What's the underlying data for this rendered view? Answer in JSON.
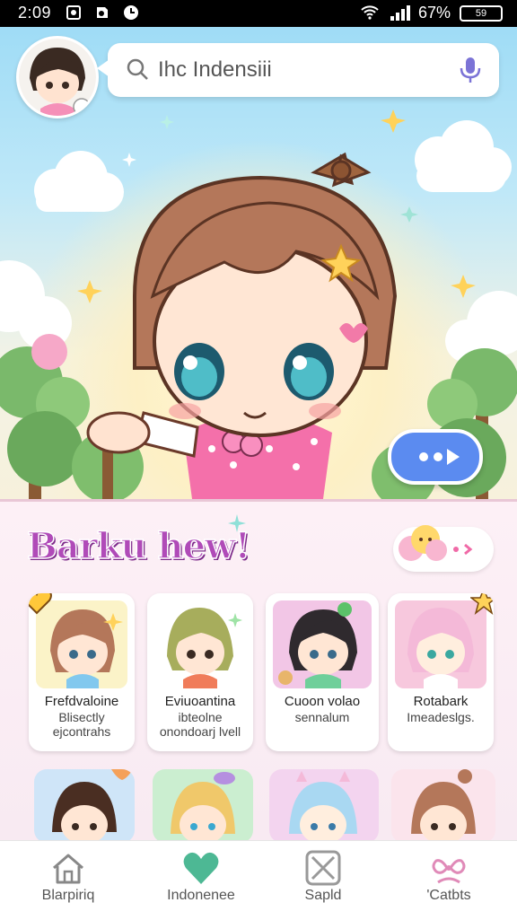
{
  "status_bar": {
    "time": "2:09",
    "battery_percent": "67%",
    "battery_label": "59"
  },
  "search": {
    "placeholder_text": "Ihc Indensiii"
  },
  "section": {
    "title": "Barku hew!"
  },
  "cards": [
    {
      "line1": "Frefdvaloine",
      "line2": "Blisectly",
      "line3": "ejcontrahs",
      "thumb_color": "#fbf3c8"
    },
    {
      "line1": "Eviuoantina",
      "line2": "ibteolne",
      "line3": "onondoarj lvell",
      "thumb_color": "#ffffff"
    },
    {
      "line1": "Cuoon volao",
      "line2": "sennalum",
      "line3": "",
      "thumb_color": "#f2c6e6"
    },
    {
      "line1": "Rotabark",
      "line2": "Imeadeslgs.",
      "line3": "",
      "thumb_color": "#f7c8dd"
    }
  ],
  "bottom_cards": [
    {
      "thumb_color": "#cfe5f8"
    },
    {
      "thumb_color": "#cbeed0"
    },
    {
      "thumb_color": "#f3d4ef"
    },
    {
      "thumb_color": "#fbe4ec"
    }
  ],
  "nav": [
    {
      "label": "Blarpiriq",
      "icon": "home-icon"
    },
    {
      "label": "Indonenee",
      "icon": "heart-icon"
    },
    {
      "label": "Sapld",
      "icon": "crossed-box-icon"
    },
    {
      "label": "'Catbts",
      "icon": "bow-icon"
    }
  ],
  "colors": {
    "accent_pink": "#f06aa7",
    "title_purple": "#b04bb8",
    "chat_blue": "#5b8bf0",
    "nav_active_green": "#4db894"
  }
}
